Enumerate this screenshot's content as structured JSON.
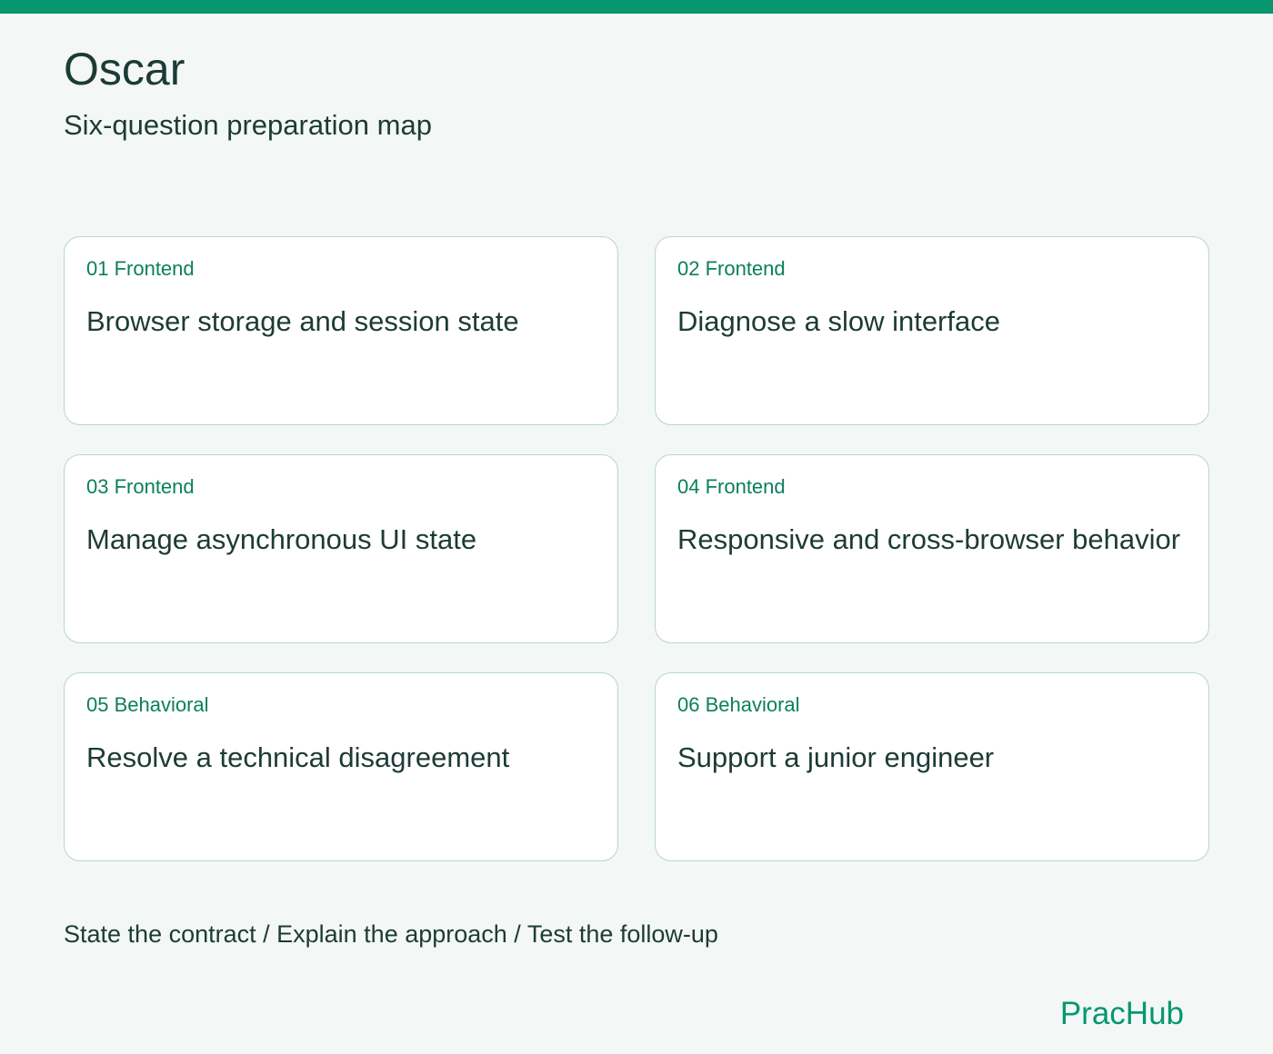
{
  "header": {
    "title": "Oscar",
    "subtitle": "Six-question preparation map"
  },
  "colors": {
    "accent": "#06976e",
    "text": "#1d3b35",
    "background": "#f3f8f6",
    "card_border": "#b7d6cc"
  },
  "cards": [
    {
      "tag": "01 Frontend",
      "title": "Browser storage and session state"
    },
    {
      "tag": "02 Frontend",
      "title": "Diagnose a slow interface"
    },
    {
      "tag": "03 Frontend",
      "title": "Manage asynchronous UI state"
    },
    {
      "tag": "04 Frontend",
      "title": "Responsive and cross-browser behavior"
    },
    {
      "tag": "05 Behavioral",
      "title": "Resolve a technical disagreement"
    },
    {
      "tag": "06 Behavioral",
      "title": "Support a junior engineer"
    }
  ],
  "footer": {
    "steps": "State the contract / Explain the approach / Test the follow-up",
    "brand": "PracHub"
  }
}
